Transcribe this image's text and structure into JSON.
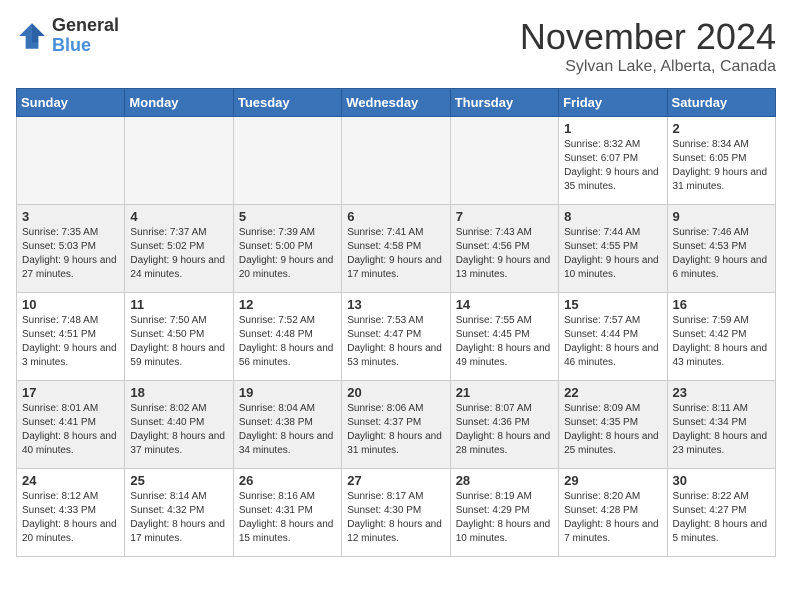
{
  "header": {
    "logo_general": "General",
    "logo_blue": "Blue",
    "month_year": "November 2024",
    "location": "Sylvan Lake, Alberta, Canada"
  },
  "days_of_week": [
    "Sunday",
    "Monday",
    "Tuesday",
    "Wednesday",
    "Thursday",
    "Friday",
    "Saturday"
  ],
  "weeks": [
    [
      {
        "day": "",
        "info": "",
        "empty": true
      },
      {
        "day": "",
        "info": "",
        "empty": true
      },
      {
        "day": "",
        "info": "",
        "empty": true
      },
      {
        "day": "",
        "info": "",
        "empty": true
      },
      {
        "day": "",
        "info": "",
        "empty": true
      },
      {
        "day": "1",
        "info": "Sunrise: 8:32 AM\nSunset: 6:07 PM\nDaylight: 9 hours and 35 minutes."
      },
      {
        "day": "2",
        "info": "Sunrise: 8:34 AM\nSunset: 6:05 PM\nDaylight: 9 hours and 31 minutes."
      }
    ],
    [
      {
        "day": "3",
        "info": "Sunrise: 7:35 AM\nSunset: 5:03 PM\nDaylight: 9 hours and 27 minutes.",
        "shaded": true
      },
      {
        "day": "4",
        "info": "Sunrise: 7:37 AM\nSunset: 5:02 PM\nDaylight: 9 hours and 24 minutes.",
        "shaded": true
      },
      {
        "day": "5",
        "info": "Sunrise: 7:39 AM\nSunset: 5:00 PM\nDaylight: 9 hours and 20 minutes.",
        "shaded": true
      },
      {
        "day": "6",
        "info": "Sunrise: 7:41 AM\nSunset: 4:58 PM\nDaylight: 9 hours and 17 minutes.",
        "shaded": true
      },
      {
        "day": "7",
        "info": "Sunrise: 7:43 AM\nSunset: 4:56 PM\nDaylight: 9 hours and 13 minutes.",
        "shaded": true
      },
      {
        "day": "8",
        "info": "Sunrise: 7:44 AM\nSunset: 4:55 PM\nDaylight: 9 hours and 10 minutes.",
        "shaded": true
      },
      {
        "day": "9",
        "info": "Sunrise: 7:46 AM\nSunset: 4:53 PM\nDaylight: 9 hours and 6 minutes.",
        "shaded": true
      }
    ],
    [
      {
        "day": "10",
        "info": "Sunrise: 7:48 AM\nSunset: 4:51 PM\nDaylight: 9 hours and 3 minutes."
      },
      {
        "day": "11",
        "info": "Sunrise: 7:50 AM\nSunset: 4:50 PM\nDaylight: 8 hours and 59 minutes."
      },
      {
        "day": "12",
        "info": "Sunrise: 7:52 AM\nSunset: 4:48 PM\nDaylight: 8 hours and 56 minutes."
      },
      {
        "day": "13",
        "info": "Sunrise: 7:53 AM\nSunset: 4:47 PM\nDaylight: 8 hours and 53 minutes."
      },
      {
        "day": "14",
        "info": "Sunrise: 7:55 AM\nSunset: 4:45 PM\nDaylight: 8 hours and 49 minutes."
      },
      {
        "day": "15",
        "info": "Sunrise: 7:57 AM\nSunset: 4:44 PM\nDaylight: 8 hours and 46 minutes."
      },
      {
        "day": "16",
        "info": "Sunrise: 7:59 AM\nSunset: 4:42 PM\nDaylight: 8 hours and 43 minutes."
      }
    ],
    [
      {
        "day": "17",
        "info": "Sunrise: 8:01 AM\nSunset: 4:41 PM\nDaylight: 8 hours and 40 minutes.",
        "shaded": true
      },
      {
        "day": "18",
        "info": "Sunrise: 8:02 AM\nSunset: 4:40 PM\nDaylight: 8 hours and 37 minutes.",
        "shaded": true
      },
      {
        "day": "19",
        "info": "Sunrise: 8:04 AM\nSunset: 4:38 PM\nDaylight: 8 hours and 34 minutes.",
        "shaded": true
      },
      {
        "day": "20",
        "info": "Sunrise: 8:06 AM\nSunset: 4:37 PM\nDaylight: 8 hours and 31 minutes.",
        "shaded": true
      },
      {
        "day": "21",
        "info": "Sunrise: 8:07 AM\nSunset: 4:36 PM\nDaylight: 8 hours and 28 minutes.",
        "shaded": true
      },
      {
        "day": "22",
        "info": "Sunrise: 8:09 AM\nSunset: 4:35 PM\nDaylight: 8 hours and 25 minutes.",
        "shaded": true
      },
      {
        "day": "23",
        "info": "Sunrise: 8:11 AM\nSunset: 4:34 PM\nDaylight: 8 hours and 23 minutes.",
        "shaded": true
      }
    ],
    [
      {
        "day": "24",
        "info": "Sunrise: 8:12 AM\nSunset: 4:33 PM\nDaylight: 8 hours and 20 minutes."
      },
      {
        "day": "25",
        "info": "Sunrise: 8:14 AM\nSunset: 4:32 PM\nDaylight: 8 hours and 17 minutes."
      },
      {
        "day": "26",
        "info": "Sunrise: 8:16 AM\nSunset: 4:31 PM\nDaylight: 8 hours and 15 minutes."
      },
      {
        "day": "27",
        "info": "Sunrise: 8:17 AM\nSunset: 4:30 PM\nDaylight: 8 hours and 12 minutes."
      },
      {
        "day": "28",
        "info": "Sunrise: 8:19 AM\nSunset: 4:29 PM\nDaylight: 8 hours and 10 minutes."
      },
      {
        "day": "29",
        "info": "Sunrise: 8:20 AM\nSunset: 4:28 PM\nDaylight: 8 hours and 7 minutes."
      },
      {
        "day": "30",
        "info": "Sunrise: 8:22 AM\nSunset: 4:27 PM\nDaylight: 8 hours and 5 minutes."
      }
    ]
  ]
}
